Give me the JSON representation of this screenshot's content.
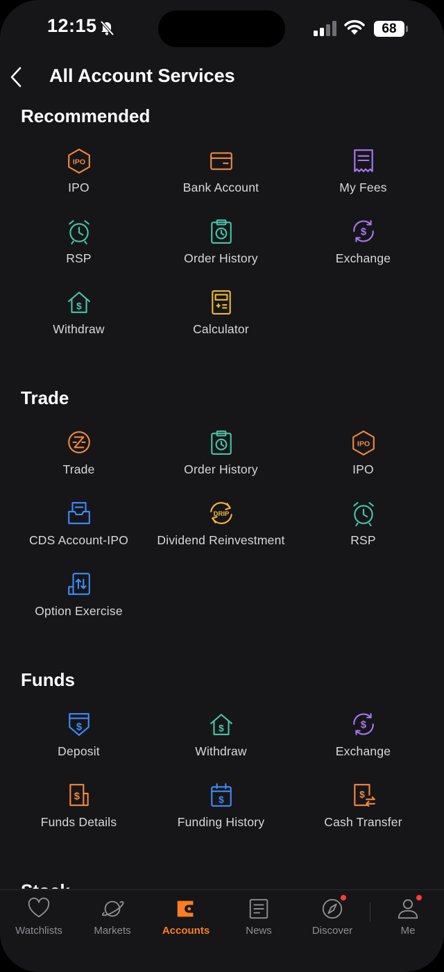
{
  "status_bar": {
    "time": "12:15",
    "battery": "68"
  },
  "header": {
    "title": "All Account Services"
  },
  "colors": {
    "orange": "#f08a3c",
    "teal": "#48c4a8",
    "purple": "#a879f0",
    "yellow": "#f0b93a",
    "blue": "#3f8bf5",
    "accent": "#ff7d1f",
    "background": "#161619",
    "text": "#d8d8dc"
  },
  "sections": [
    {
      "title": "Recommended",
      "items": [
        {
          "label": "IPO",
          "icon": "ipo-icon",
          "color": "#f08a3c"
        },
        {
          "label": "Bank Account",
          "icon": "bank-card-icon",
          "color": "#f08a3c"
        },
        {
          "label": "My Fees",
          "icon": "receipt-icon",
          "color": "#a879f0"
        },
        {
          "label": "RSP",
          "icon": "alarm-clock-icon",
          "color": "#48c4a8"
        },
        {
          "label": "Order History",
          "icon": "clipboard-clock-icon",
          "color": "#48c4a8"
        },
        {
          "label": "Exchange",
          "icon": "currency-exchange-icon",
          "color": "#a879f0"
        },
        {
          "label": "Withdraw",
          "icon": "house-dollar-icon",
          "color": "#48c4a8"
        },
        {
          "label": "Calculator",
          "icon": "calculator-icon",
          "color": "#f0b93a"
        }
      ]
    },
    {
      "title": "Trade",
      "items": [
        {
          "label": "Trade",
          "icon": "trade-icon",
          "color": "#f08a3c"
        },
        {
          "label": "Order History",
          "icon": "clipboard-clock-icon",
          "color": "#48c4a8"
        },
        {
          "label": "IPO",
          "icon": "ipo-icon",
          "color": "#f08a3c"
        },
        {
          "label": "CDS Account-IPO",
          "icon": "tray-document-icon",
          "color": "#3f8bf5"
        },
        {
          "label": "Dividend Reinvestment",
          "icon": "drip-icon",
          "color": "#f0b93a"
        },
        {
          "label": "RSP",
          "icon": "alarm-clock-icon",
          "color": "#48c4a8"
        },
        {
          "label": "Option Exercise",
          "icon": "option-exercise-icon",
          "color": "#3f8bf5"
        }
      ]
    },
    {
      "title": "Funds",
      "items": [
        {
          "label": "Deposit",
          "icon": "deposit-icon",
          "color": "#3f8bf5"
        },
        {
          "label": "Withdraw",
          "icon": "house-dollar-icon",
          "color": "#48c4a8"
        },
        {
          "label": "Exchange",
          "icon": "currency-exchange-icon",
          "color": "#a879f0"
        },
        {
          "label": "Funds Details",
          "icon": "funds-details-icon",
          "color": "#f08a3c"
        },
        {
          "label": "Funding History",
          "icon": "calendar-dollar-icon",
          "color": "#3f8bf5"
        },
        {
          "label": "Cash Transfer",
          "icon": "cash-transfer-icon",
          "color": "#f08a3c"
        }
      ]
    },
    {
      "title": "Stock",
      "items": []
    }
  ],
  "tabs": [
    {
      "label": "Watchlists",
      "icon": "heart-icon",
      "active": false,
      "badge": false
    },
    {
      "label": "Markets",
      "icon": "planet-icon",
      "active": false,
      "badge": false
    },
    {
      "label": "Accounts",
      "icon": "wallet-icon",
      "active": true,
      "badge": false
    },
    {
      "label": "News",
      "icon": "news-icon",
      "active": false,
      "badge": false
    },
    {
      "label": "Discover",
      "icon": "compass-icon",
      "active": false,
      "badge": true
    },
    {
      "label": "Me",
      "icon": "person-icon",
      "active": false,
      "badge": true
    }
  ]
}
